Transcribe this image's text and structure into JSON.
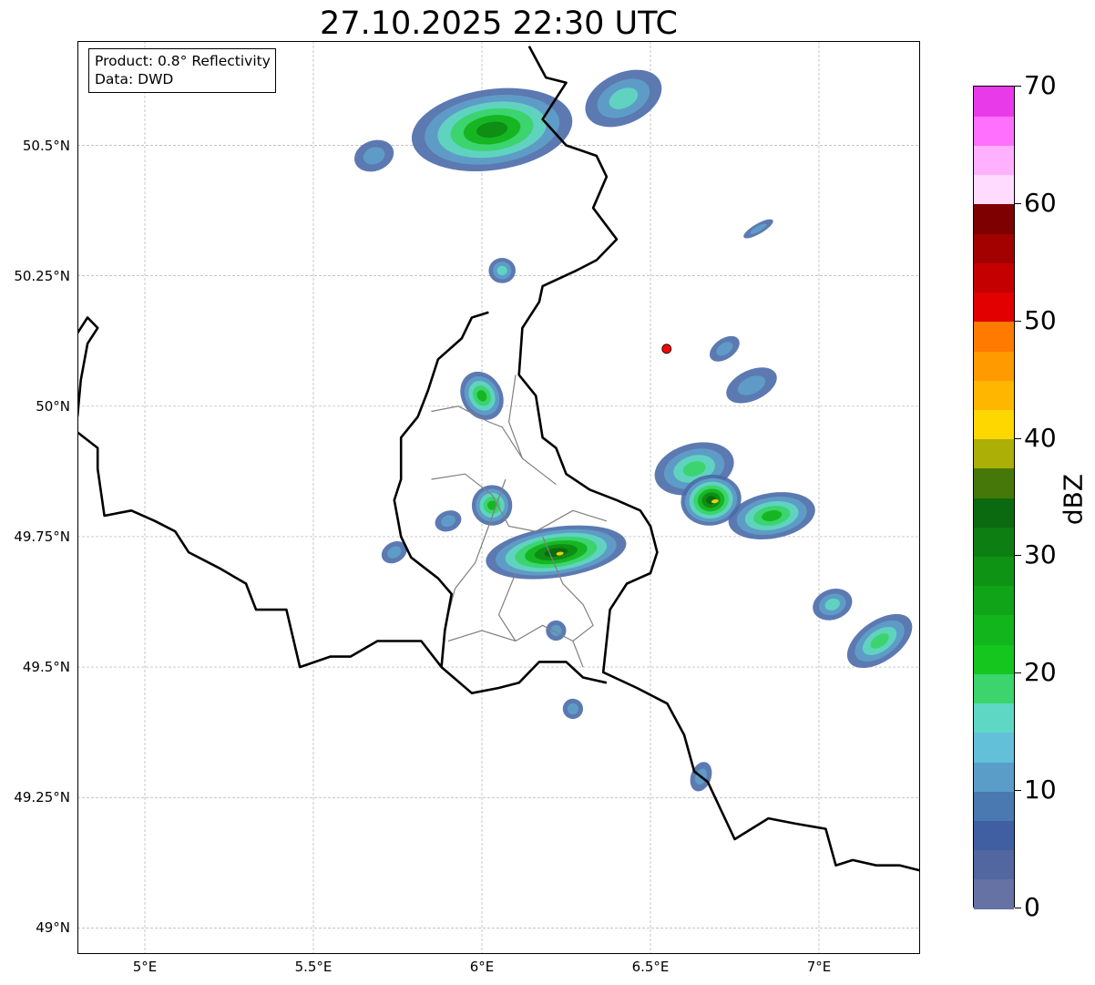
{
  "title": "27.10.2025 22:30 UTC",
  "info": {
    "product": "Product: 0.8° Reflectivity",
    "data": "Data: DWD"
  },
  "map": {
    "extent": {
      "lon_min": 4.8,
      "lon_max": 7.3,
      "lat_min": 48.95,
      "lat_max": 50.7
    },
    "lat_ticks": [
      {
        "value": 49.0,
        "label": "49°N"
      },
      {
        "value": 49.25,
        "label": "49.25°N"
      },
      {
        "value": 49.5,
        "label": "49.5°N"
      },
      {
        "value": 49.75,
        "label": "49.75°N"
      },
      {
        "value": 50.0,
        "label": "50°N"
      },
      {
        "value": 50.25,
        "label": "50.25°N"
      },
      {
        "value": 50.5,
        "label": "50.5°N"
      }
    ],
    "lon_ticks": [
      {
        "value": 5.0,
        "label": "5°E"
      },
      {
        "value": 5.5,
        "label": "5.5°E"
      },
      {
        "value": 6.0,
        "label": "6°E"
      },
      {
        "value": 6.5,
        "label": "6.5°E"
      },
      {
        "value": 7.0,
        "label": "7°E"
      }
    ],
    "grid": true,
    "radar_site": {
      "lon": 6.548,
      "lat": 50.11,
      "color": "#ff0000"
    },
    "echo_palette": {
      "weak": "#4a6aa8",
      "light": "#5e9ec8",
      "cyan": "#60d6c0",
      "mid_green": "#3ad46a",
      "green": "#14b41e",
      "strong_green": "#0e8c14",
      "dark_green": "#086a10",
      "yellow": "#f4d000"
    },
    "echo_cells": [
      {
        "lon": 6.03,
        "lat": 50.53,
        "rx": 0.24,
        "ry": 0.08,
        "angle": -8,
        "level": 5
      },
      {
        "lon": 5.68,
        "lat": 50.48,
        "rx": 0.06,
        "ry": 0.03,
        "angle": -20,
        "level": 1
      },
      {
        "lon": 6.42,
        "lat": 50.59,
        "rx": 0.12,
        "ry": 0.05,
        "angle": -25,
        "level": 2
      },
      {
        "lon": 6.06,
        "lat": 50.26,
        "rx": 0.04,
        "ry": 0.025,
        "angle": 0,
        "level": 2
      },
      {
        "lon": 6.0,
        "lat": 50.02,
        "rx": 0.06,
        "ry": 0.05,
        "angle": -30,
        "level": 4
      },
      {
        "lon": 6.03,
        "lat": 49.81,
        "rx": 0.06,
        "ry": 0.04,
        "angle": -30,
        "level": 4
      },
      {
        "lon": 6.22,
        "lat": 49.72,
        "rx": 0.21,
        "ry": 0.05,
        "angle": -8,
        "level": 6
      },
      {
        "lon": 5.74,
        "lat": 49.72,
        "rx": 0.04,
        "ry": 0.02,
        "angle": -30,
        "level": 1
      },
      {
        "lon": 5.9,
        "lat": 49.78,
        "rx": 0.04,
        "ry": 0.02,
        "angle": -20,
        "level": 1
      },
      {
        "lon": 6.63,
        "lat": 49.88,
        "rx": 0.12,
        "ry": 0.05,
        "angle": -15,
        "level": 3
      },
      {
        "lon": 6.68,
        "lat": 49.82,
        "rx": 0.09,
        "ry": 0.05,
        "angle": -10,
        "level": 6
      },
      {
        "lon": 6.86,
        "lat": 49.79,
        "rx": 0.13,
        "ry": 0.045,
        "angle": -10,
        "level": 4
      },
      {
        "lon": 6.8,
        "lat": 50.04,
        "rx": 0.08,
        "ry": 0.03,
        "angle": -25,
        "level": 1
      },
      {
        "lon": 6.72,
        "lat": 50.11,
        "rx": 0.05,
        "ry": 0.02,
        "angle": -35,
        "level": 1
      },
      {
        "lon": 6.82,
        "lat": 50.34,
        "rx": 0.05,
        "ry": 0.01,
        "angle": -30,
        "level": 1
      },
      {
        "lon": 7.04,
        "lat": 49.62,
        "rx": 0.06,
        "ry": 0.03,
        "angle": -20,
        "level": 2
      },
      {
        "lon": 7.18,
        "lat": 49.55,
        "rx": 0.11,
        "ry": 0.04,
        "angle": -35,
        "level": 3
      },
      {
        "lon": 6.22,
        "lat": 49.57,
        "rx": 0.03,
        "ry": 0.02,
        "angle": -30,
        "level": 1
      },
      {
        "lon": 6.27,
        "lat": 49.42,
        "rx": 0.03,
        "ry": 0.02,
        "angle": 10,
        "level": 1
      },
      {
        "lon": 6.65,
        "lat": 49.29,
        "rx": 0.03,
        "ry": 0.03,
        "angle": 20,
        "level": 1
      }
    ],
    "country_border_east": [
      [
        6.14,
        50.69
      ],
      [
        6.19,
        50.63
      ],
      [
        6.25,
        50.62
      ],
      [
        6.18,
        50.55
      ],
      [
        6.25,
        50.5
      ],
      [
        6.34,
        50.48
      ],
      [
        6.37,
        50.44
      ],
      [
        6.33,
        50.38
      ],
      [
        6.4,
        50.32
      ],
      [
        6.34,
        50.28
      ],
      [
        6.28,
        50.26
      ],
      [
        6.18,
        50.23
      ],
      [
        6.17,
        50.2
      ],
      [
        6.12,
        50.15
      ],
      [
        6.11,
        50.06
      ],
      [
        6.16,
        50.02
      ],
      [
        6.18,
        49.94
      ],
      [
        6.22,
        49.92
      ],
      [
        6.25,
        49.87
      ],
      [
        6.32,
        49.84
      ],
      [
        6.4,
        49.82
      ],
      [
        6.47,
        49.8
      ],
      [
        6.5,
        49.77
      ],
      [
        6.52,
        49.72
      ],
      [
        6.5,
        49.68
      ],
      [
        6.43,
        49.66
      ],
      [
        6.38,
        49.61
      ],
      [
        6.37,
        49.55
      ],
      [
        6.36,
        49.49
      ],
      [
        6.46,
        49.46
      ],
      [
        6.55,
        49.43
      ],
      [
        6.6,
        49.37
      ],
      [
        6.63,
        49.3
      ],
      [
        6.67,
        49.28
      ],
      [
        6.75,
        49.17
      ],
      [
        6.85,
        49.21
      ],
      [
        6.93,
        49.2
      ],
      [
        7.02,
        49.19
      ],
      [
        7.05,
        49.12
      ],
      [
        7.1,
        49.13
      ],
      [
        7.17,
        49.12
      ],
      [
        7.24,
        49.12
      ],
      [
        7.3,
        49.11
      ]
    ],
    "country_border_west": [
      [
        4.8,
        49.95
      ],
      [
        4.86,
        49.92
      ],
      [
        4.86,
        49.88
      ],
      [
        4.88,
        49.79
      ],
      [
        4.96,
        49.8
      ],
      [
        5.03,
        49.78
      ],
      [
        5.09,
        49.76
      ],
      [
        5.13,
        49.72
      ],
      [
        5.22,
        49.69
      ],
      [
        5.3,
        49.66
      ],
      [
        5.33,
        49.61
      ],
      [
        5.42,
        49.61
      ],
      [
        5.46,
        49.5
      ],
      [
        5.55,
        49.52
      ],
      [
        5.61,
        49.52
      ],
      [
        5.69,
        49.55
      ],
      [
        5.76,
        49.55
      ],
      [
        5.82,
        49.55
      ],
      [
        5.88,
        49.5
      ],
      [
        5.97,
        49.45
      ],
      [
        6.05,
        49.46
      ],
      [
        6.11,
        49.47
      ],
      [
        6.17,
        49.51
      ],
      [
        6.25,
        49.51
      ],
      [
        6.3,
        49.48
      ],
      [
        6.37,
        49.47
      ]
    ],
    "lux_border": [
      [
        6.02,
        50.18
      ],
      [
        5.97,
        50.17
      ],
      [
        5.94,
        50.13
      ],
      [
        5.87,
        50.09
      ],
      [
        5.84,
        50.03
      ],
      [
        5.81,
        49.98
      ],
      [
        5.76,
        49.94
      ],
      [
        5.76,
        49.86
      ],
      [
        5.74,
        49.82
      ],
      [
        5.76,
        49.75
      ],
      [
        5.79,
        49.71
      ],
      [
        5.87,
        49.67
      ],
      [
        5.91,
        49.64
      ],
      [
        5.89,
        49.57
      ],
      [
        5.88,
        49.5
      ]
    ],
    "belgium_west": [
      [
        4.8,
        50.14
      ],
      [
        4.83,
        50.17
      ],
      [
        4.86,
        50.15
      ],
      [
        4.83,
        50.12
      ],
      [
        4.81,
        50.05
      ],
      [
        4.8,
        49.98
      ]
    ],
    "inner_boundaries": [
      [
        [
          5.85,
          49.99
        ],
        [
          5.93,
          50.0
        ],
        [
          6.02,
          49.97
        ],
        [
          6.06,
          49.96
        ],
        [
          6.12,
          49.9
        ],
        [
          6.22,
          49.85
        ]
      ],
      [
        [
          5.85,
          49.86
        ],
        [
          5.95,
          49.87
        ],
        [
          6.03,
          49.83
        ],
        [
          6.08,
          49.77
        ],
        [
          6.16,
          49.76
        ],
        [
          6.27,
          49.8
        ],
        [
          6.37,
          49.78
        ]
      ],
      [
        [
          6.07,
          49.86
        ],
        [
          6.02,
          49.77
        ],
        [
          5.98,
          49.7
        ],
        [
          5.92,
          49.65
        ],
        [
          5.9,
          49.6
        ]
      ],
      [
        [
          5.9,
          49.55
        ],
        [
          6.0,
          49.57
        ],
        [
          6.1,
          49.55
        ],
        [
          6.18,
          49.58
        ],
        [
          6.27,
          49.55
        ],
        [
          6.3,
          49.5
        ]
      ],
      [
        [
          6.1,
          49.68
        ],
        [
          6.05,
          49.6
        ],
        [
          6.1,
          49.55
        ]
      ],
      [
        [
          6.18,
          49.75
        ],
        [
          6.24,
          49.66
        ],
        [
          6.3,
          49.62
        ],
        [
          6.33,
          49.58
        ],
        [
          6.27,
          49.55
        ]
      ],
      [
        [
          6.12,
          49.9
        ],
        [
          6.08,
          49.97
        ],
        [
          6.1,
          50.06
        ]
      ]
    ]
  },
  "colorbar": {
    "label": "dBZ",
    "min": 0,
    "max": 70,
    "step": 2.5,
    "tick_labels": [
      {
        "value": 0,
        "label": "0"
      },
      {
        "value": 10,
        "label": "10"
      },
      {
        "value": 20,
        "label": "20"
      },
      {
        "value": 30,
        "label": "30"
      },
      {
        "value": 40,
        "label": "40"
      },
      {
        "value": 50,
        "label": "50"
      },
      {
        "value": 60,
        "label": "60"
      },
      {
        "value": 70,
        "label": "70"
      }
    ],
    "colors": [
      "#6572a3",
      "#5267a0",
      "#405ea2",
      "#4a78b1",
      "#5a9dc8",
      "#62c0d8",
      "#5fd7c5",
      "#3bd46d",
      "#14c61e",
      "#12b51b",
      "#10a418",
      "#0f9315",
      "#0d7f12",
      "#0b6a0f",
      "#467809",
      "#abaf06",
      "#fed700",
      "#ffb600",
      "#ff9a00",
      "#ff7a00",
      "#e20000",
      "#c50000",
      "#a30000",
      "#7e0000",
      "#ffdcff",
      "#ffb0ff",
      "#ff70ff",
      "#e93ae9"
    ]
  }
}
